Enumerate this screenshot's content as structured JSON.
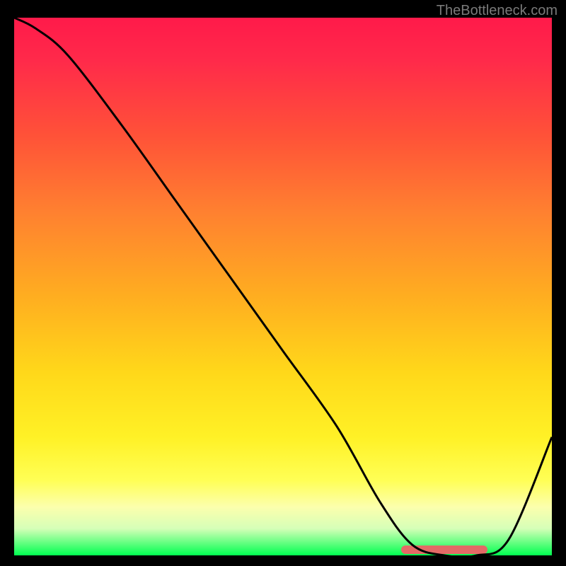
{
  "watermark": "TheBottleneck.com",
  "chart_data": {
    "type": "line",
    "title": "",
    "xlabel": "",
    "ylabel": "",
    "xlim": [
      0,
      100
    ],
    "ylim": [
      0,
      100
    ],
    "series": [
      {
        "name": "curve",
        "x": [
          0,
          4,
          10,
          20,
          30,
          40,
          50,
          60,
          68,
          74,
          80,
          86,
          92,
          100
        ],
        "y": [
          100,
          98,
          93,
          80,
          66,
          52,
          38,
          24,
          10,
          2,
          0,
          0,
          3,
          22
        ]
      }
    ],
    "highlight_range": {
      "x_start": 72,
      "x_end": 88,
      "color": "#e36a66"
    },
    "gradient_stops": [
      {
        "pos": 0,
        "color": "#ff1a4a"
      },
      {
        "pos": 22,
        "color": "#ff5238"
      },
      {
        "pos": 52,
        "color": "#ffae20"
      },
      {
        "pos": 78,
        "color": "#fff126"
      },
      {
        "pos": 95,
        "color": "#d6ffb8"
      },
      {
        "pos": 100,
        "color": "#00ff50"
      }
    ]
  }
}
